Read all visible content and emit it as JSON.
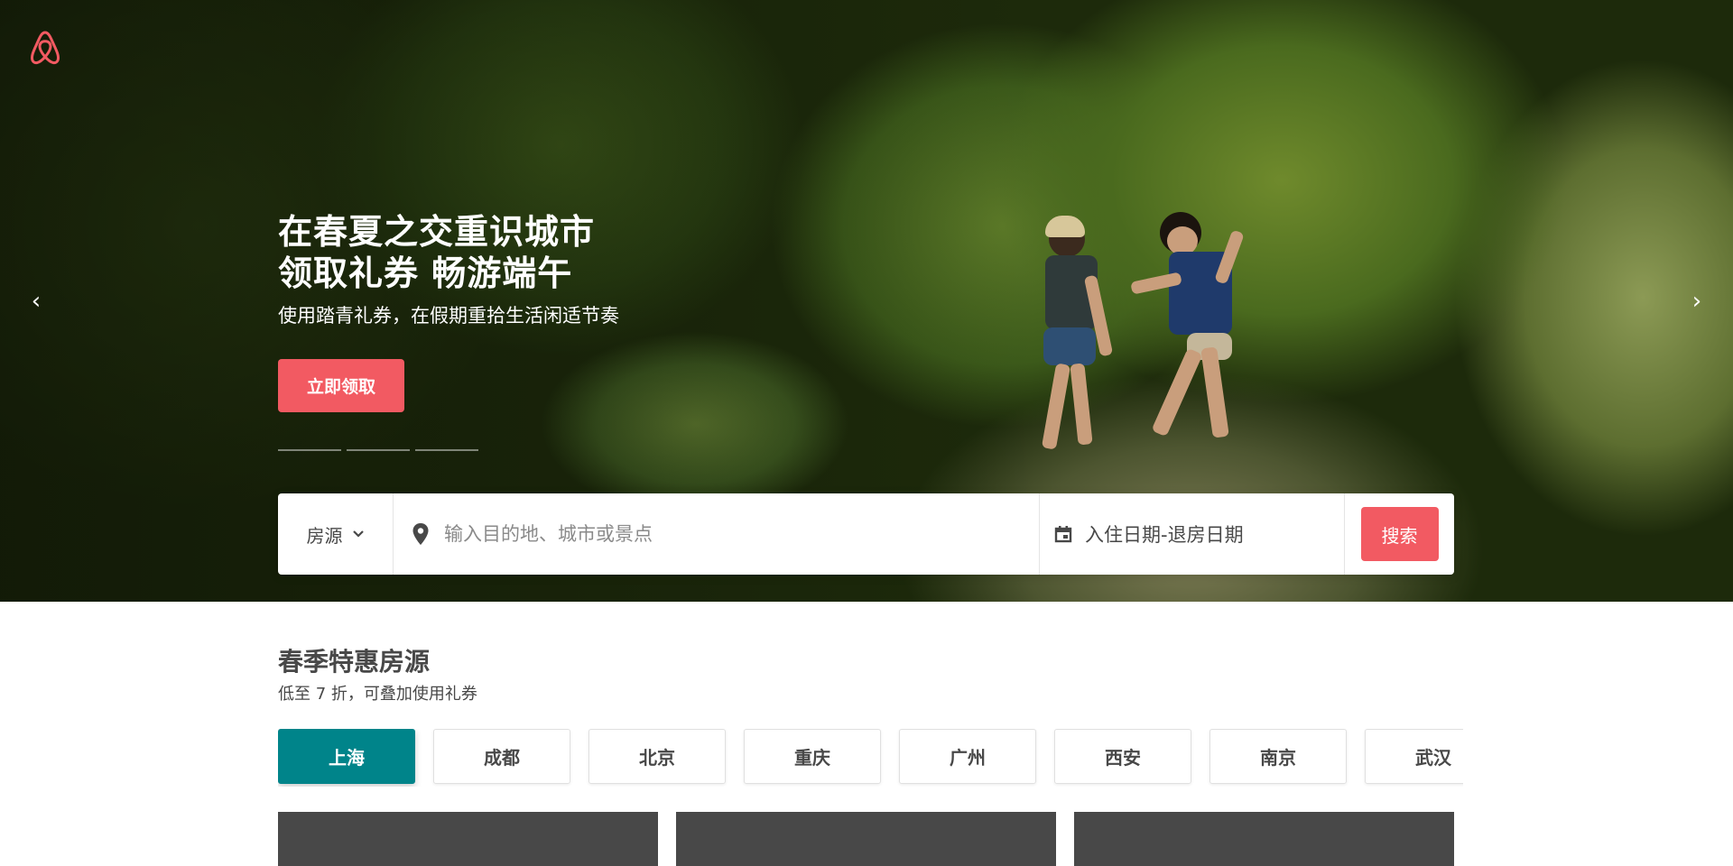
{
  "hero": {
    "title_line1": "在春夏之交重识城市",
    "title_line2": "领取礼券 畅游端午",
    "subtitle": "使用踏青礼券，在假期重拾生活闲适节奏",
    "cta_label": "立即领取",
    "slide_count": 3,
    "prev_arrow": "‹",
    "next_arrow": "›"
  },
  "search": {
    "type_label": "房源",
    "destination_placeholder": "输入目的地、城市或景点",
    "dates_label": "入住日期-退房日期",
    "button_label": "搜索"
  },
  "deals": {
    "title": "春季特惠房源",
    "subtitle": "低至 7 折，可叠加使用礼券",
    "cities": [
      "上海",
      "成都",
      "北京",
      "重庆",
      "广州",
      "西安",
      "南京",
      "武汉"
    ],
    "active_city": "上海"
  },
  "icons": {
    "logo": "airbnb-logo-icon",
    "location": "map-pin-icon",
    "calendar": "calendar-icon",
    "dropdown": "chevron-down-icon"
  },
  "colors": {
    "brand": "#f25a62",
    "active_tab": "#00848a",
    "text": "#484848",
    "card_placeholder": "#484848"
  }
}
